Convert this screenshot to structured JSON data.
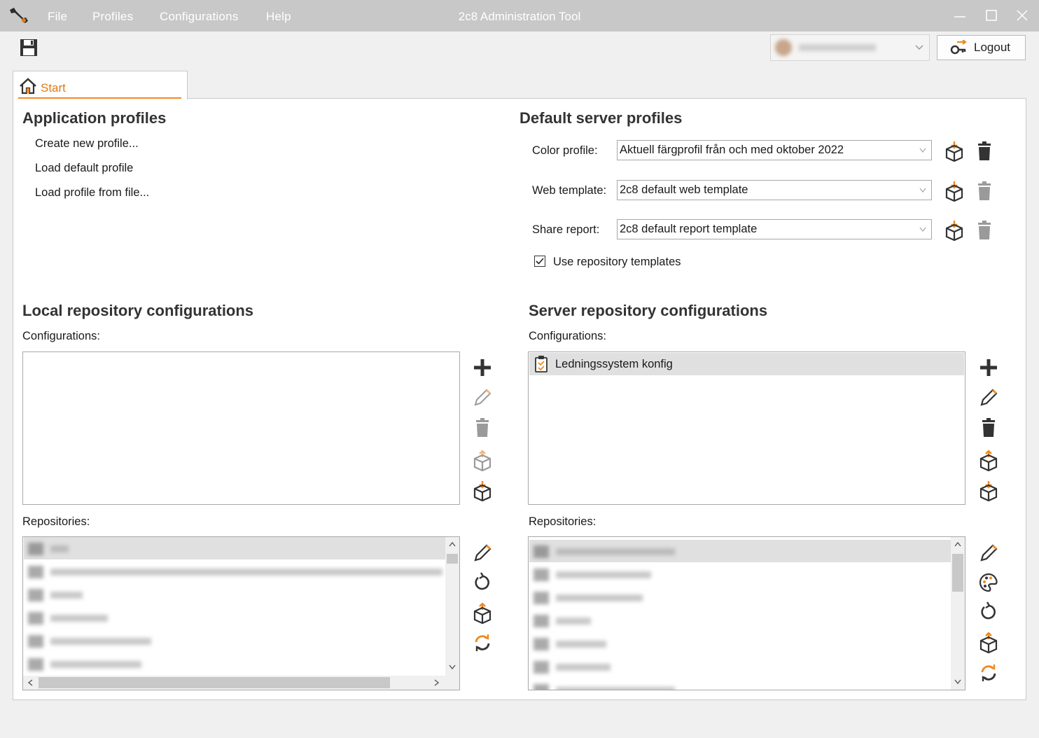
{
  "window": {
    "title": "2c8 Administration Tool",
    "menu": [
      "File",
      "Profiles",
      "Configurations",
      "Help"
    ]
  },
  "toolbar": {
    "logout_label": "Logout",
    "user_combo_value": ""
  },
  "tabs": [
    {
      "label": "Start"
    }
  ],
  "application_profiles": {
    "title": "Application profiles",
    "actions": [
      "Create new profile...",
      "Load default profile",
      "Load profile from file..."
    ]
  },
  "default_server_profiles": {
    "title": "Default server profiles",
    "rows": [
      {
        "label": "Color profile:",
        "value": "Aktuell färgprofil från och med oktober 2022"
      },
      {
        "label": "Web template:",
        "value": "2c8 default web template"
      },
      {
        "label": "Share report:",
        "value": "2c8 default report template"
      }
    ],
    "use_repo_templates": {
      "label": "Use repository templates",
      "checked": true
    }
  },
  "local_repo": {
    "title": "Local repository configurations",
    "configurations_label": "Configurations:",
    "configurations": [],
    "repositories_label": "Repositories:"
  },
  "server_repo": {
    "title": "Server repository configurations",
    "configurations_label": "Configurations:",
    "configurations": [
      "Ledningssystem konfig"
    ],
    "repositories_label": "Repositories:"
  },
  "colors": {
    "accent": "#f08a24",
    "icon_dark": "#3c3c3c",
    "icon_disabled": "#9a9a9a"
  }
}
